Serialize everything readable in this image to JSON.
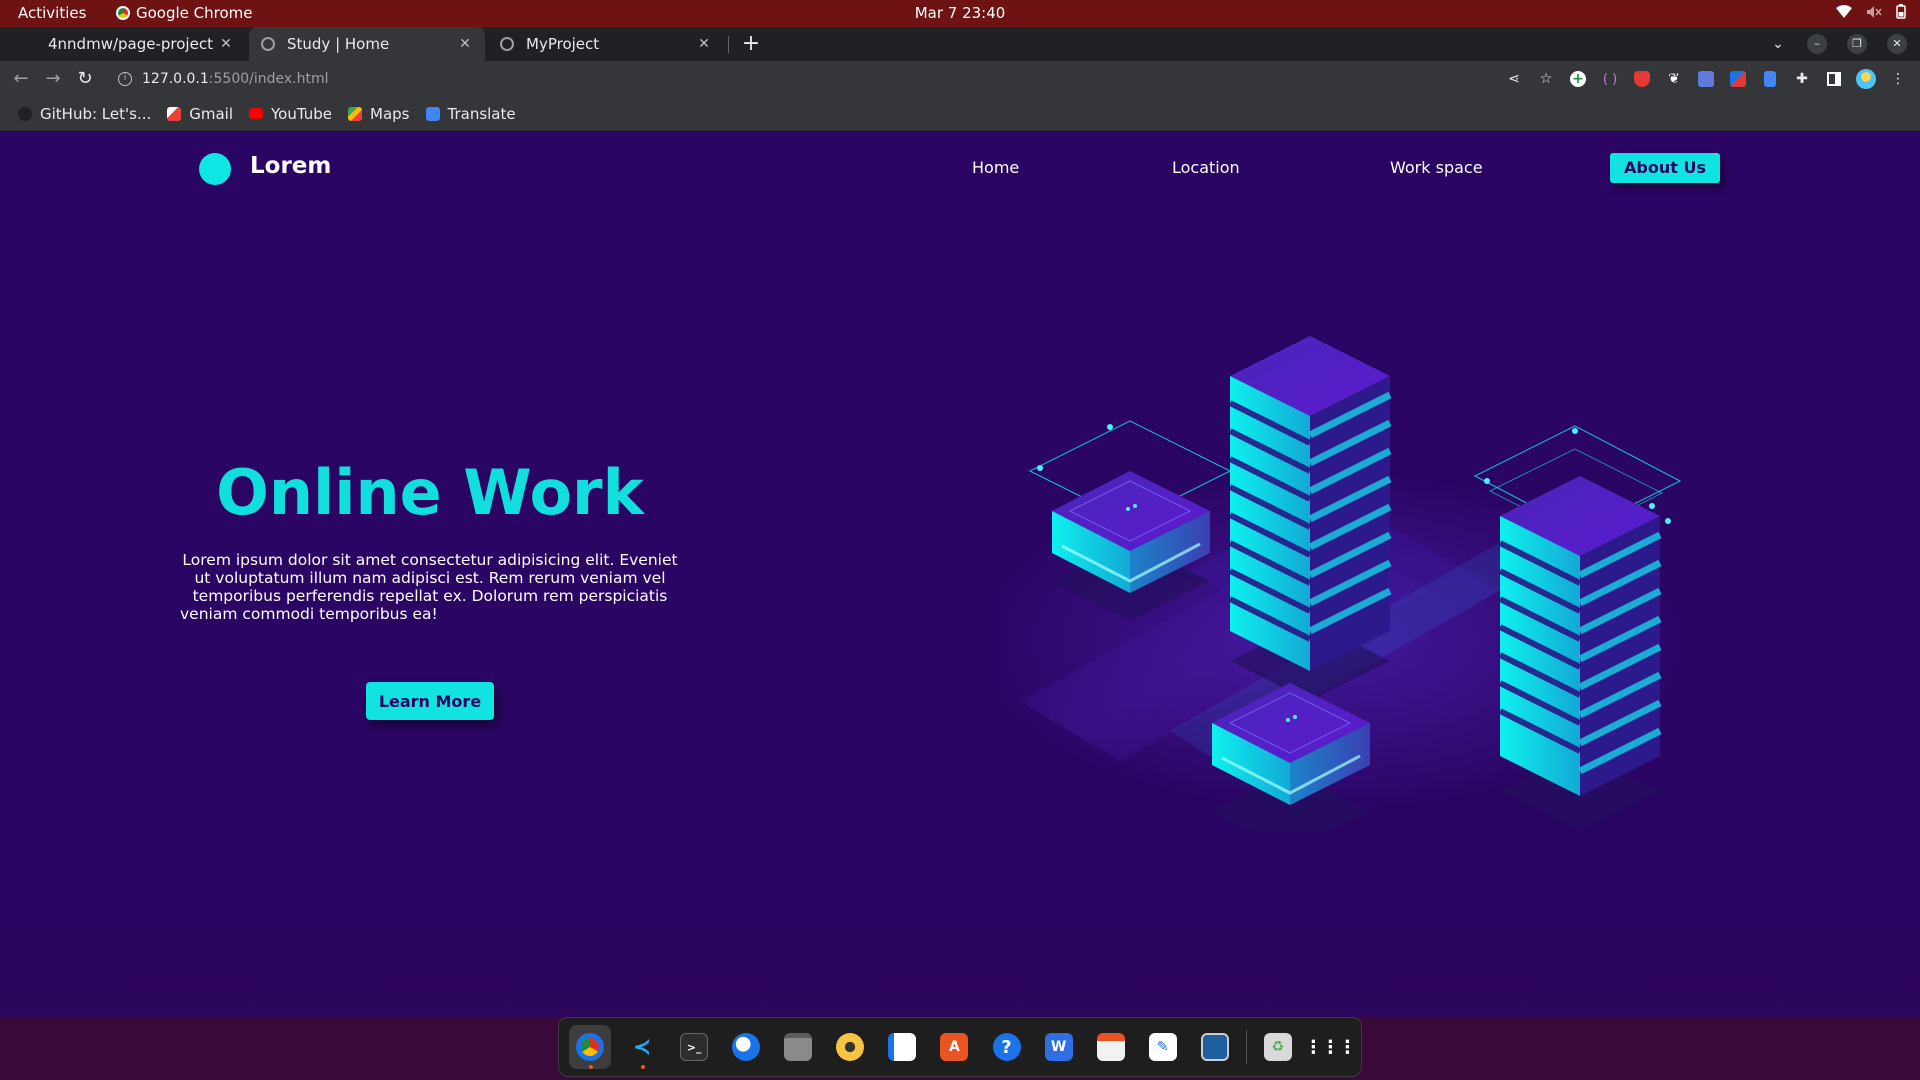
{
  "system_bar": {
    "activities": "Activities",
    "app_name": "Google Chrome",
    "clock": "Mar 7  23:40"
  },
  "tabs": [
    {
      "title": "4nndmw/page-project",
      "active": false
    },
    {
      "title": "Study | Home",
      "active": true
    },
    {
      "title": "MyProject",
      "active": false
    }
  ],
  "address_bar": {
    "host": "127.0.0.1",
    "path": ":5500/index.html"
  },
  "bookmarks": [
    {
      "label": "GitHub: Let's...",
      "icon": "github-icon"
    },
    {
      "label": "Gmail",
      "icon": "gmail-icon"
    },
    {
      "label": "YouTube",
      "icon": "youtube-icon"
    },
    {
      "label": "Maps",
      "icon": "maps-icon"
    },
    {
      "label": "Translate",
      "icon": "translate-icon"
    }
  ],
  "page": {
    "logo": "Lorem",
    "nav": [
      "Home",
      "Location",
      "Work space"
    ],
    "cta_nav": "About Us",
    "hero_title": "Online Work",
    "hero_text": "Lorem ipsum dolor sit amet consectetur adipisicing elit. Eveniet ut voluptatum illum nam adipisci est. Rem rerum veniam vel temporibus perferendis repellat ex. Dolorum rem perspiciatis veniam commodi temporibus ea!",
    "hero_button": "Learn More",
    "colors": {
      "accent": "#11e3e1",
      "background": "#2b0563",
      "button_text": "#2a0561"
    }
  },
  "dock": [
    {
      "name": "chrome-icon",
      "active": true
    },
    {
      "name": "vscode-icon"
    },
    {
      "name": "terminal-icon"
    },
    {
      "name": "thunderbird-icon"
    },
    {
      "name": "files-icon"
    },
    {
      "name": "rhythmbox-icon"
    },
    {
      "name": "libreoffice-writer-icon"
    },
    {
      "name": "software-center-icon"
    },
    {
      "name": "help-icon"
    },
    {
      "name": "wps-writer-icon"
    },
    {
      "name": "app-icon"
    },
    {
      "name": "text-editor-icon"
    },
    {
      "name": "screenshot-icon"
    },
    {
      "name": "trash-icon"
    },
    {
      "name": "show-apps-icon"
    }
  ]
}
